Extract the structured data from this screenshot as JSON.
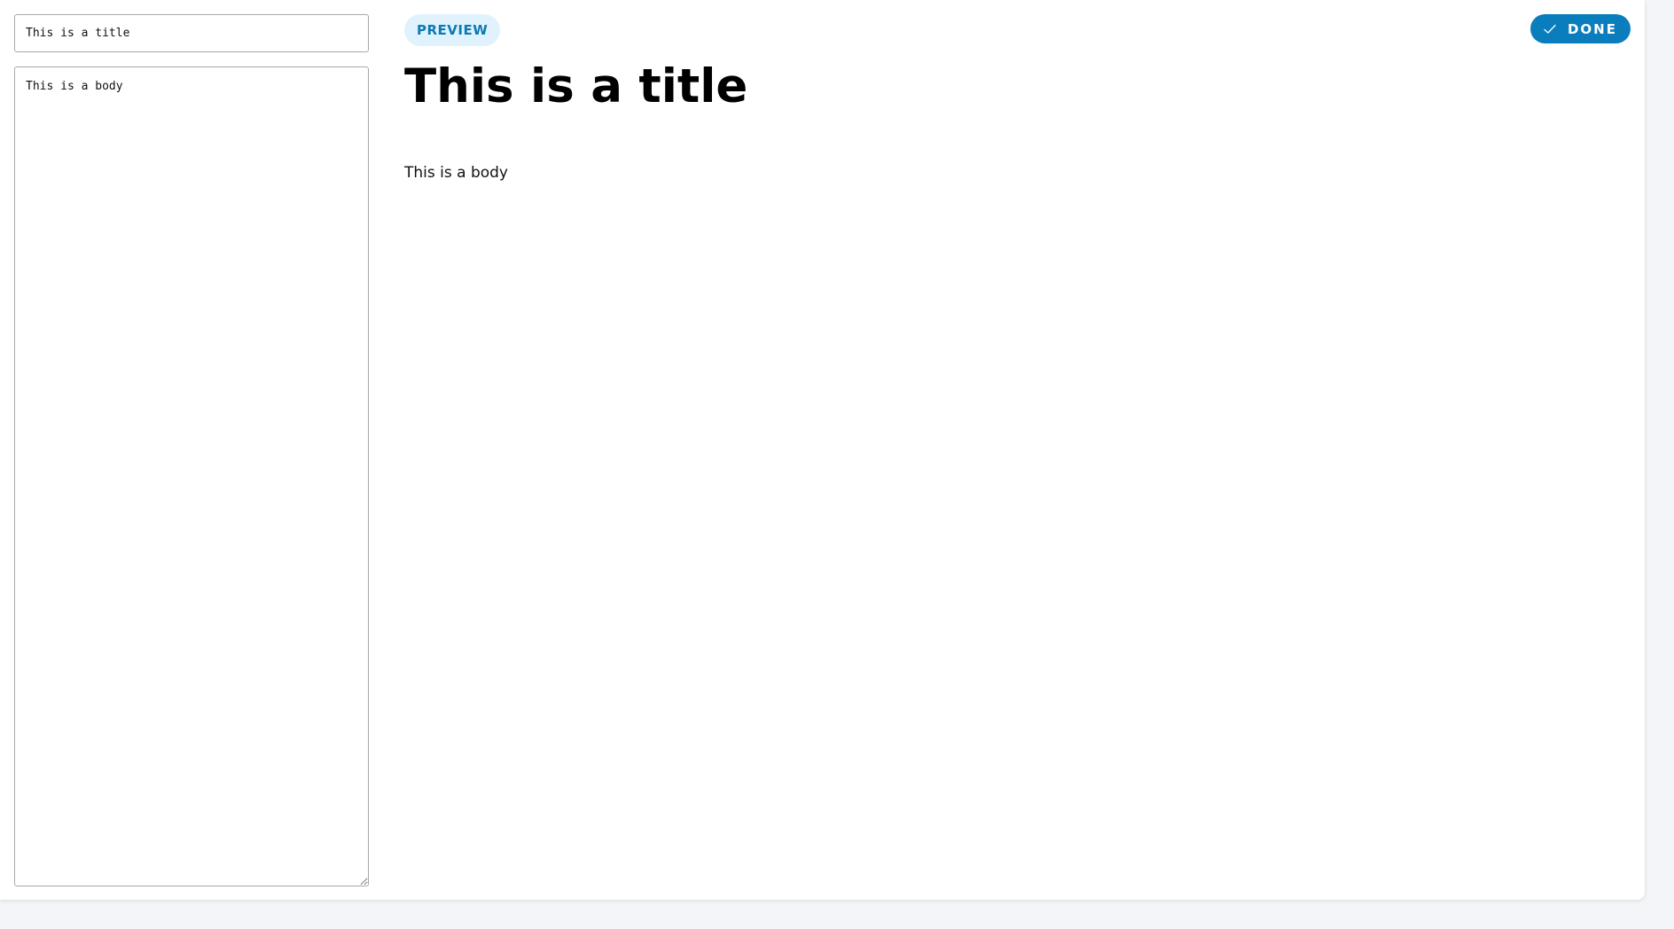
{
  "editor": {
    "title_value": "This is a title",
    "body_value": "This is a body"
  },
  "preview": {
    "badge_label": "PREVIEW",
    "title": "This is a title",
    "body": "This is a body"
  },
  "toolbar": {
    "done_label": "DONE",
    "done_icon": "check-icon"
  },
  "colors": {
    "accent": "#0a7dbd",
    "badge_bg": "#e0f3fc",
    "badge_text": "#0b79b5"
  }
}
